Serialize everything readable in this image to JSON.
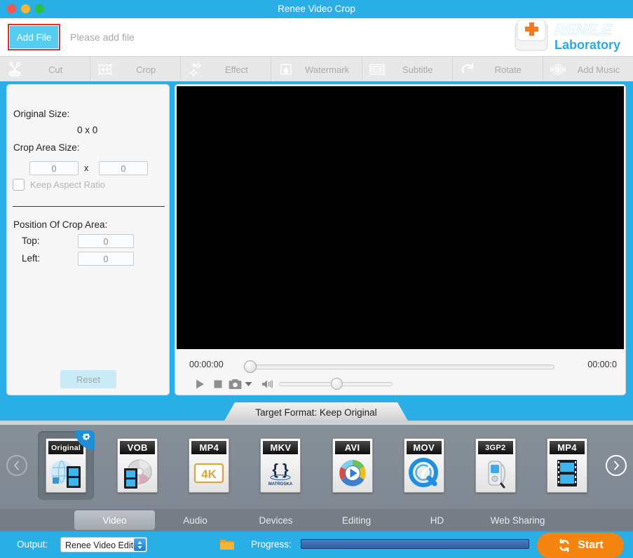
{
  "window": {
    "title": "Renee Video Crop",
    "traffic_lights": [
      "close",
      "minimize",
      "zoom"
    ]
  },
  "header": {
    "add_file_label": "Add File",
    "file_placeholder": "Please add file",
    "logo_name": "RENE.E",
    "logo_sub": "Laboratory",
    "accent_red": "#e03127",
    "accent_cyan": "#55cdf0",
    "brand_blue": "#29aee6"
  },
  "toolbar": {
    "items": [
      {
        "label": "Cut",
        "icon": "scissors-icon"
      },
      {
        "label": "Crop",
        "icon": "crop-frame-icon"
      },
      {
        "label": "Effect",
        "icon": "stars-icon"
      },
      {
        "label": "Watermark",
        "icon": "droplet-icon"
      },
      {
        "label": "Subtitle",
        "icon": "subtitle-film-icon"
      },
      {
        "label": "Rotate",
        "icon": "rotate-icon"
      },
      {
        "label": "Add Music",
        "icon": "speaker-waves-icon"
      }
    ]
  },
  "crop_panel": {
    "original_size_label": "Original Size:",
    "original_size_value": "0 x 0",
    "crop_area_size_label": "Crop Area Size:",
    "crop_width": "0",
    "crop_height": "0",
    "size_separator": "x",
    "keep_aspect_label": "Keep Aspect Ratio",
    "keep_aspect_checked": false,
    "position_label": "Position Of Crop Area:",
    "top_label": "Top:",
    "top_value": "0",
    "left_label": "Left:",
    "left_value": "0",
    "reset_label": "Reset"
  },
  "player": {
    "time_current": "00:00:00",
    "time_total": "00:00:0",
    "seek_percent": 0,
    "volume_percent": 46,
    "controls": [
      {
        "name": "play-button",
        "icon": "play-icon"
      },
      {
        "name": "stop-button",
        "icon": "stop-icon"
      },
      {
        "name": "snapshot-button",
        "icon": "camera-icon"
      },
      {
        "name": "snapshot-menu-button",
        "icon": "caret-down-icon"
      },
      {
        "name": "volume-button",
        "icon": "volume-icon"
      }
    ]
  },
  "format": {
    "tab_label": "Target Format: Keep Original",
    "prev_arrow": "chevron-left-icon",
    "next_arrow": "chevron-right-icon",
    "selected_index": 0,
    "tiles": [
      {
        "label": "Original",
        "art": "globe-film-icon",
        "selected": true,
        "badge": "gear-icon"
      },
      {
        "label": "VOB",
        "art": "disc-film-icon",
        "selected": false
      },
      {
        "label": "MP4",
        "art": "4k-icon",
        "selected": false
      },
      {
        "label": "MKV",
        "art": "matroska-icon",
        "selected": false,
        "sub": "MATROSKA"
      },
      {
        "label": "AVI",
        "art": "color-wheel-play-icon",
        "selected": false
      },
      {
        "label": "MOV",
        "art": "quicktime-icon",
        "selected": false
      },
      {
        "label": "3GP2",
        "art": "mobile-phone-icon",
        "selected": false
      },
      {
        "label": "MP4",
        "art": "film-strip-icon",
        "selected": false
      }
    ]
  },
  "categories": {
    "items": [
      {
        "label": "Video",
        "active": true
      },
      {
        "label": "Audio",
        "active": false
      },
      {
        "label": "Devices",
        "active": false
      },
      {
        "label": "Editing",
        "active": false
      },
      {
        "label": "HD",
        "active": false
      },
      {
        "label": "Web Sharing",
        "active": false
      }
    ]
  },
  "bottom": {
    "output_label": "Output:",
    "output_value": "Renee Video Editor",
    "browse_icon": "folder-icon",
    "progress_label": "Progress:",
    "progress_percent": 100,
    "start_label": "Start",
    "start_icon": "refresh-icon",
    "start_color": "#f58410"
  }
}
